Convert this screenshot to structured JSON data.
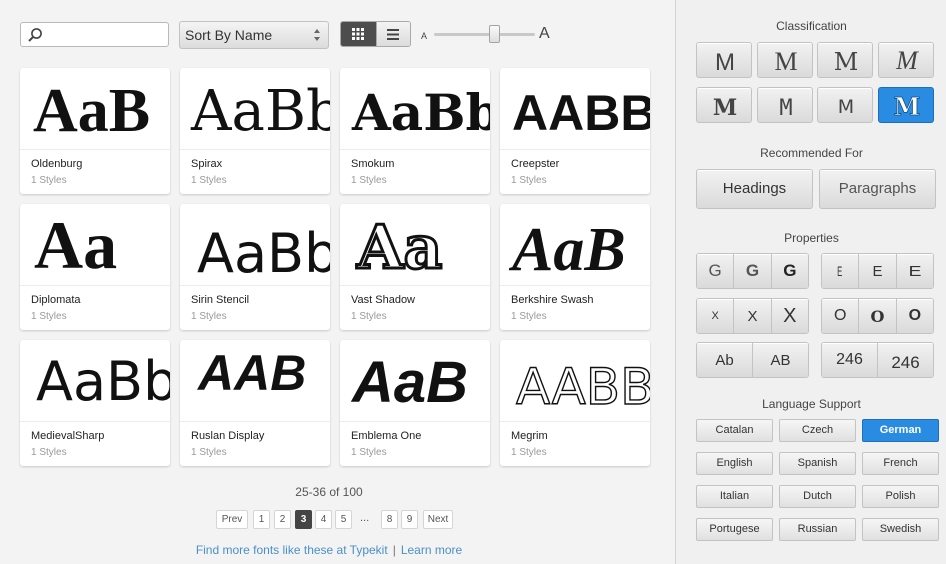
{
  "toolbar": {
    "search_placeholder": "",
    "sort_label": "Sort By Name",
    "size_small_label": "A",
    "size_large_label": "A",
    "size_slider_value": 0.55
  },
  "fonts": [
    {
      "name": "Oldenburg",
      "styles": "1 Styles",
      "sample": "AaB"
    },
    {
      "name": "Spirax",
      "styles": "1 Styles",
      "sample": "AaBb"
    },
    {
      "name": "Smokum",
      "styles": "1 Styles",
      "sample": "AaBbC"
    },
    {
      "name": "Creepster",
      "styles": "1 Styles",
      "sample": "AABBC"
    },
    {
      "name": "Diplomata",
      "styles": "1 Styles",
      "sample": "Aa"
    },
    {
      "name": "Sirin Stencil",
      "styles": "1 Styles",
      "sample": "AaBb"
    },
    {
      "name": "Vast Shadow",
      "styles": "1 Styles",
      "sample": "Aa"
    },
    {
      "name": "Berkshire Swash",
      "styles": "1 Styles",
      "sample": "AaB"
    },
    {
      "name": "MedievalSharp",
      "styles": "1 Styles",
      "sample": "AaBb"
    },
    {
      "name": "Ruslan Display",
      "styles": "1 Styles",
      "sample": "AAB"
    },
    {
      "name": "Emblema One",
      "styles": "1 Styles",
      "sample": "AaB"
    },
    {
      "name": "Megrim",
      "styles": "1 Styles",
      "sample": "AABB"
    }
  ],
  "pagination": {
    "range_text": "25-36 of 100",
    "prev_label": "Prev",
    "next_label": "Next",
    "pages": [
      "1",
      "2",
      "3",
      "4",
      "5",
      "8",
      "9"
    ],
    "current": "3",
    "ellipsis": "..."
  },
  "footer": {
    "typekit_link": "Find more fonts like these at Typekit",
    "separator": "|",
    "learn_more": "Learn more"
  },
  "sidebar": {
    "classification_heading": "Classification",
    "classification_glyph": "M",
    "classification_items": [
      "sans-serif",
      "serif",
      "slab-serif",
      "script",
      "blackletter",
      "monospaced",
      "handwritten",
      "decorative"
    ],
    "classification_active": "decorative",
    "recommended_heading": "Recommended For",
    "recommended": [
      "Headings",
      "Paragraphs"
    ],
    "properties_heading": "Properties",
    "weight_glyph": "G",
    "width_glyph": "E",
    "xheight_glyph": "X",
    "contrast_glyph": "O",
    "caps_labels": [
      "Ab",
      "AB"
    ],
    "numerals_labels": [
      "246",
      "246"
    ],
    "language_heading": "Language Support",
    "languages": [
      "Catalan",
      "Czech",
      "German",
      "English",
      "Spanish",
      "French",
      "Italian",
      "Dutch",
      "Polish",
      "Portugese",
      "Russian",
      "Swedish"
    ],
    "language_active": "German",
    "accent_color": "#2a8be2"
  }
}
